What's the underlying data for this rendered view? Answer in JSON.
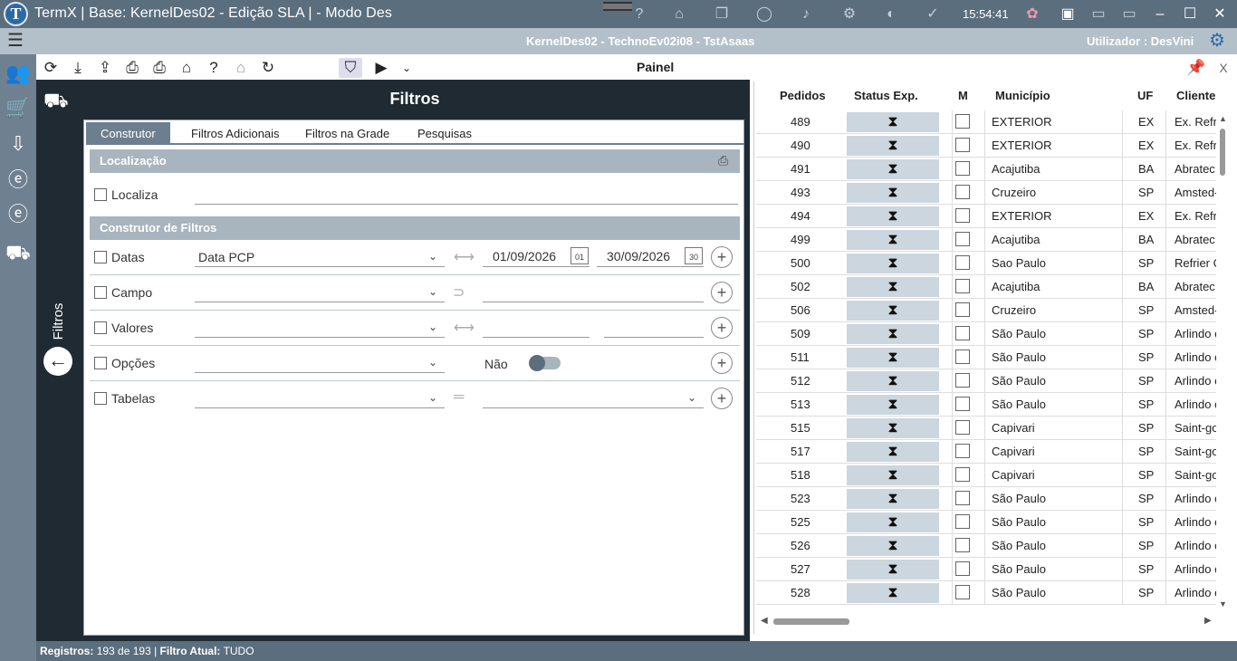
{
  "window": {
    "title": "TermX | Base: KernelDes02 - Edição SLA | - Modo Des",
    "clock": "15:54:41"
  },
  "subbar": {
    "center": "KernelDes02 - TechnoEv02i08 - TstAsaas",
    "user": "Utilizador :  DesVini"
  },
  "toolbar": {
    "panel_title": "Painel",
    "close": "X"
  },
  "filters": {
    "title": "Filtros",
    "side_label": "Filtros",
    "tabs": [
      "Construtor",
      "Filtros Adicionais",
      "Filtros na Grade",
      "Pesquisas"
    ],
    "section_localizacao": "Localização",
    "localiza_label": "Localiza",
    "section_construtor": "Construtor de Filtros",
    "datas_label": "Datas",
    "datas_select": "Data PCP",
    "date_from": "01/09/2026",
    "date_to": "30/09/2026",
    "date_from_day": "01",
    "date_to_day": "30",
    "campo_label": "Campo",
    "valores_label": "Valores",
    "opcoes_label": "Opções",
    "opcoes_toggle": "Não",
    "tabelas_label": "Tabelas"
  },
  "grid": {
    "columns": [
      "Pedidos",
      "Status Exp.",
      "M",
      "Município",
      "UF",
      "Cliente"
    ],
    "rows": [
      {
        "pedido": "489",
        "municipio": "EXTERIOR",
        "uf": "EX",
        "cliente": "Ex. Refrig"
      },
      {
        "pedido": "490",
        "municipio": "EXTERIOR",
        "uf": "EX",
        "cliente": "Ex. Refrig"
      },
      {
        "pedido": "491",
        "municipio": "Acajutiba",
        "uf": "BA",
        "cliente": "Abratec"
      },
      {
        "pedido": "493",
        "municipio": "Cruzeiro",
        "uf": "SP",
        "cliente": "Amsted-"
      },
      {
        "pedido": "494",
        "municipio": "EXTERIOR",
        "uf": "EX",
        "cliente": "Ex. Refrig"
      },
      {
        "pedido": "499",
        "municipio": "Acajutiba",
        "uf": "BA",
        "cliente": "Abratec"
      },
      {
        "pedido": "500",
        "municipio": "Sao Paulo",
        "uf": "SP",
        "cliente": "Refrier C"
      },
      {
        "pedido": "502",
        "municipio": "Acajutiba",
        "uf": "BA",
        "cliente": "Abratec"
      },
      {
        "pedido": "506",
        "municipio": "Cruzeiro",
        "uf": "SP",
        "cliente": "Amsted-"
      },
      {
        "pedido": "509",
        "municipio": "São Paulo",
        "uf": "SP",
        "cliente": "Arlindo c"
      },
      {
        "pedido": "511",
        "municipio": "São Paulo",
        "uf": "SP",
        "cliente": "Arlindo c"
      },
      {
        "pedido": "512",
        "municipio": "São Paulo",
        "uf": "SP",
        "cliente": "Arlindo c"
      },
      {
        "pedido": "513",
        "municipio": "São Paulo",
        "uf": "SP",
        "cliente": "Arlindo c"
      },
      {
        "pedido": "515",
        "municipio": "Capivari",
        "uf": "SP",
        "cliente": "Saint-go"
      },
      {
        "pedido": "517",
        "municipio": "Capivari",
        "uf": "SP",
        "cliente": "Saint-go"
      },
      {
        "pedido": "518",
        "municipio": "Capivari",
        "uf": "SP",
        "cliente": "Saint-go"
      },
      {
        "pedido": "523",
        "municipio": "São Paulo",
        "uf": "SP",
        "cliente": "Arlindo c"
      },
      {
        "pedido": "525",
        "municipio": "São Paulo",
        "uf": "SP",
        "cliente": "Arlindo c"
      },
      {
        "pedido": "526",
        "municipio": "São Paulo",
        "uf": "SP",
        "cliente": "Arlindo c"
      },
      {
        "pedido": "527",
        "municipio": "São Paulo",
        "uf": "SP",
        "cliente": "Arlindo c"
      },
      {
        "pedido": "528",
        "municipio": "São Paulo",
        "uf": "SP",
        "cliente": "Arlindo c"
      }
    ]
  },
  "status": {
    "registros_label": "Registros:",
    "registros_value": "193 de 193",
    "filtro_label": "Filtro Atual:",
    "filtro_value": "TUDO"
  },
  "icons": {
    "status_icon": "hourglass-icon"
  }
}
